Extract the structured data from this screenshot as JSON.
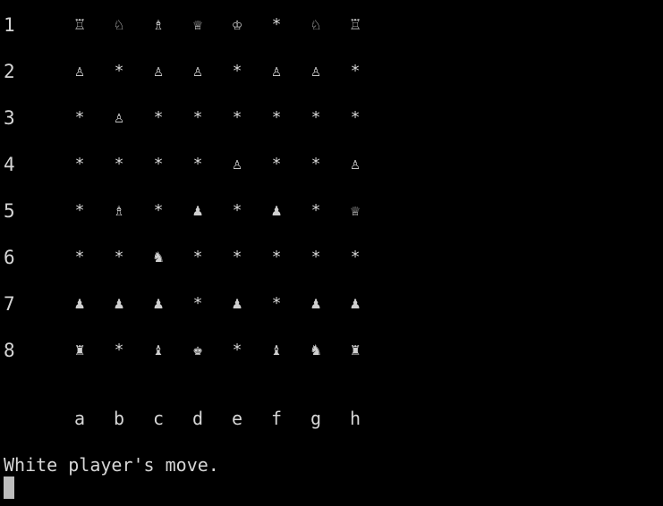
{
  "board": {
    "ranks": [
      {
        "label": "1",
        "cells": [
          "♖",
          "♘",
          "♗",
          "♕",
          "♔",
          "*",
          "♘",
          "♖"
        ]
      },
      {
        "label": "2",
        "cells": [
          "♙",
          "*",
          "♙",
          "♙",
          "*",
          "♙",
          "♙",
          "*"
        ]
      },
      {
        "label": "3",
        "cells": [
          "*",
          "♙",
          "*",
          "*",
          "*",
          "*",
          "*",
          "*"
        ]
      },
      {
        "label": "4",
        "cells": [
          "*",
          "*",
          "*",
          "*",
          "♙",
          "*",
          "*",
          "♙"
        ]
      },
      {
        "label": "5",
        "cells": [
          "*",
          "♗",
          "*",
          "♟",
          "*",
          "♟",
          "*",
          "♕"
        ]
      },
      {
        "label": "6",
        "cells": [
          "*",
          "*",
          "♞",
          "*",
          "*",
          "*",
          "*",
          "*"
        ]
      },
      {
        "label": "7",
        "cells": [
          "♟",
          "♟",
          "♟",
          "*",
          "♟",
          "*",
          "♟",
          "♟"
        ]
      },
      {
        "label": "8",
        "cells": [
          "♜",
          "*",
          "♝",
          "♚",
          "*",
          "♝",
          "♞",
          "♜"
        ]
      }
    ],
    "files": [
      "a",
      "b",
      "c",
      "d",
      "e",
      "f",
      "g",
      "h"
    ]
  },
  "status": {
    "message": "White player's move."
  }
}
